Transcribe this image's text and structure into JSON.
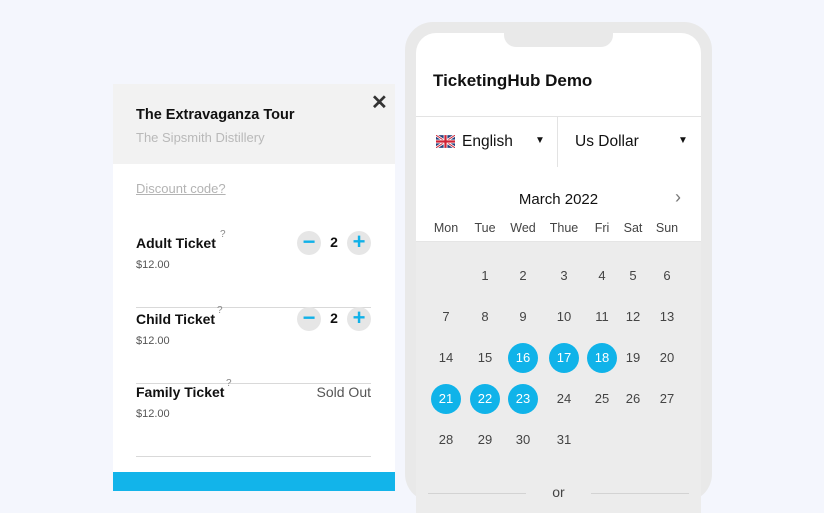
{
  "booking": {
    "title": "The Extravaganza Tour",
    "venue": "The Sipsmith Distillery",
    "discount_link": "Discount code?",
    "tickets": [
      {
        "name": "Adult Ticket",
        "help": "?",
        "price": "$12.00",
        "quantity": "2",
        "minus": "−",
        "plus": "+"
      },
      {
        "name": "Child Ticket",
        "help": "?",
        "price": "$12.00",
        "quantity": "2",
        "minus": "−",
        "plus": "+"
      },
      {
        "name": "Family Ticket",
        "help": "?",
        "price": "$12.00",
        "status": "Sold Out"
      }
    ],
    "close_icon": "close-icon",
    "accent_color": "#12b4ea"
  },
  "phone": {
    "app_title": "TicketingHub Demo",
    "language": "English",
    "currency": "Us Dollar",
    "calendar": {
      "month": "March 2022",
      "weekdays": [
        "Mon",
        "Tue",
        "Wed",
        "Thue",
        "Fri",
        "Sat",
        "Sun"
      ],
      "weeks": [
        [
          "",
          "1",
          "2",
          "3",
          "4",
          "5",
          "6"
        ],
        [
          "7",
          "8",
          "9",
          "10",
          "11",
          "12",
          "13"
        ],
        [
          "14",
          "15",
          "16",
          "17",
          "18",
          "19",
          "20"
        ],
        [
          "21",
          "22",
          "23",
          "24",
          "25",
          "26",
          "27"
        ],
        [
          "28",
          "29",
          "30",
          "31",
          "",
          "",
          ""
        ]
      ],
      "available_days": [
        "16",
        "17",
        "18",
        "21",
        "22",
        "23"
      ],
      "available_color": "#10b3e9",
      "next_icon": "chevron-right-icon"
    },
    "or_label": "or"
  }
}
